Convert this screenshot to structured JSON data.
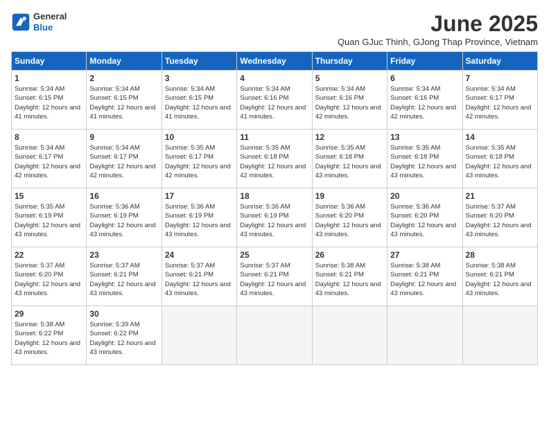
{
  "header": {
    "logo": {
      "general": "General",
      "blue": "Blue"
    },
    "title": "June 2025",
    "subtitle": "Quan GJuc Thinh, GJong Thap Province, Vietnam"
  },
  "weekdays": [
    "Sunday",
    "Monday",
    "Tuesday",
    "Wednesday",
    "Thursday",
    "Friday",
    "Saturday"
  ],
  "weeks": [
    [
      {
        "day": "1",
        "sunrise": "5:34 AM",
        "sunset": "6:15 PM",
        "daylight": "12 hours and 41 minutes."
      },
      {
        "day": "2",
        "sunrise": "5:34 AM",
        "sunset": "6:15 PM",
        "daylight": "12 hours and 41 minutes."
      },
      {
        "day": "3",
        "sunrise": "5:34 AM",
        "sunset": "6:15 PM",
        "daylight": "12 hours and 41 minutes."
      },
      {
        "day": "4",
        "sunrise": "5:34 AM",
        "sunset": "6:16 PM",
        "daylight": "12 hours and 41 minutes."
      },
      {
        "day": "5",
        "sunrise": "5:34 AM",
        "sunset": "6:16 PM",
        "daylight": "12 hours and 42 minutes."
      },
      {
        "day": "6",
        "sunrise": "5:34 AM",
        "sunset": "6:16 PM",
        "daylight": "12 hours and 42 minutes."
      },
      {
        "day": "7",
        "sunrise": "5:34 AM",
        "sunset": "6:17 PM",
        "daylight": "12 hours and 42 minutes."
      }
    ],
    [
      {
        "day": "8",
        "sunrise": "5:34 AM",
        "sunset": "6:17 PM",
        "daylight": "12 hours and 42 minutes."
      },
      {
        "day": "9",
        "sunrise": "5:34 AM",
        "sunset": "6:17 PM",
        "daylight": "12 hours and 42 minutes."
      },
      {
        "day": "10",
        "sunrise": "5:35 AM",
        "sunset": "6:17 PM",
        "daylight": "12 hours and 42 minutes."
      },
      {
        "day": "11",
        "sunrise": "5:35 AM",
        "sunset": "6:18 PM",
        "daylight": "12 hours and 42 minutes."
      },
      {
        "day": "12",
        "sunrise": "5:35 AM",
        "sunset": "6:18 PM",
        "daylight": "12 hours and 43 minutes."
      },
      {
        "day": "13",
        "sunrise": "5:35 AM",
        "sunset": "6:18 PM",
        "daylight": "12 hours and 43 minutes."
      },
      {
        "day": "14",
        "sunrise": "5:35 AM",
        "sunset": "6:18 PM",
        "daylight": "12 hours and 43 minutes."
      }
    ],
    [
      {
        "day": "15",
        "sunrise": "5:35 AM",
        "sunset": "6:19 PM",
        "daylight": "12 hours and 43 minutes."
      },
      {
        "day": "16",
        "sunrise": "5:36 AM",
        "sunset": "6:19 PM",
        "daylight": "12 hours and 43 minutes."
      },
      {
        "day": "17",
        "sunrise": "5:36 AM",
        "sunset": "6:19 PM",
        "daylight": "12 hours and 43 minutes."
      },
      {
        "day": "18",
        "sunrise": "5:36 AM",
        "sunset": "6:19 PM",
        "daylight": "12 hours and 43 minutes."
      },
      {
        "day": "19",
        "sunrise": "5:36 AM",
        "sunset": "6:20 PM",
        "daylight": "12 hours and 43 minutes."
      },
      {
        "day": "20",
        "sunrise": "5:36 AM",
        "sunset": "6:20 PM",
        "daylight": "12 hours and 43 minutes."
      },
      {
        "day": "21",
        "sunrise": "5:37 AM",
        "sunset": "6:20 PM",
        "daylight": "12 hours and 43 minutes."
      }
    ],
    [
      {
        "day": "22",
        "sunrise": "5:37 AM",
        "sunset": "6:20 PM",
        "daylight": "12 hours and 43 minutes."
      },
      {
        "day": "23",
        "sunrise": "5:37 AM",
        "sunset": "6:21 PM",
        "daylight": "12 hours and 43 minutes."
      },
      {
        "day": "24",
        "sunrise": "5:37 AM",
        "sunset": "6:21 PM",
        "daylight": "12 hours and 43 minutes."
      },
      {
        "day": "25",
        "sunrise": "5:37 AM",
        "sunset": "6:21 PM",
        "daylight": "12 hours and 43 minutes."
      },
      {
        "day": "26",
        "sunrise": "5:38 AM",
        "sunset": "6:21 PM",
        "daylight": "12 hours and 43 minutes."
      },
      {
        "day": "27",
        "sunrise": "5:38 AM",
        "sunset": "6:21 PM",
        "daylight": "12 hours and 43 minutes."
      },
      {
        "day": "28",
        "sunrise": "5:38 AM",
        "sunset": "6:21 PM",
        "daylight": "12 hours and 43 minutes."
      }
    ],
    [
      {
        "day": "29",
        "sunrise": "5:38 AM",
        "sunset": "6:22 PM",
        "daylight": "12 hours and 43 minutes."
      },
      {
        "day": "30",
        "sunrise": "5:39 AM",
        "sunset": "6:22 PM",
        "daylight": "12 hours and 43 minutes."
      },
      null,
      null,
      null,
      null,
      null
    ]
  ],
  "labels": {
    "sunrise": "Sunrise:",
    "sunset": "Sunset:",
    "daylight": "Daylight:"
  }
}
